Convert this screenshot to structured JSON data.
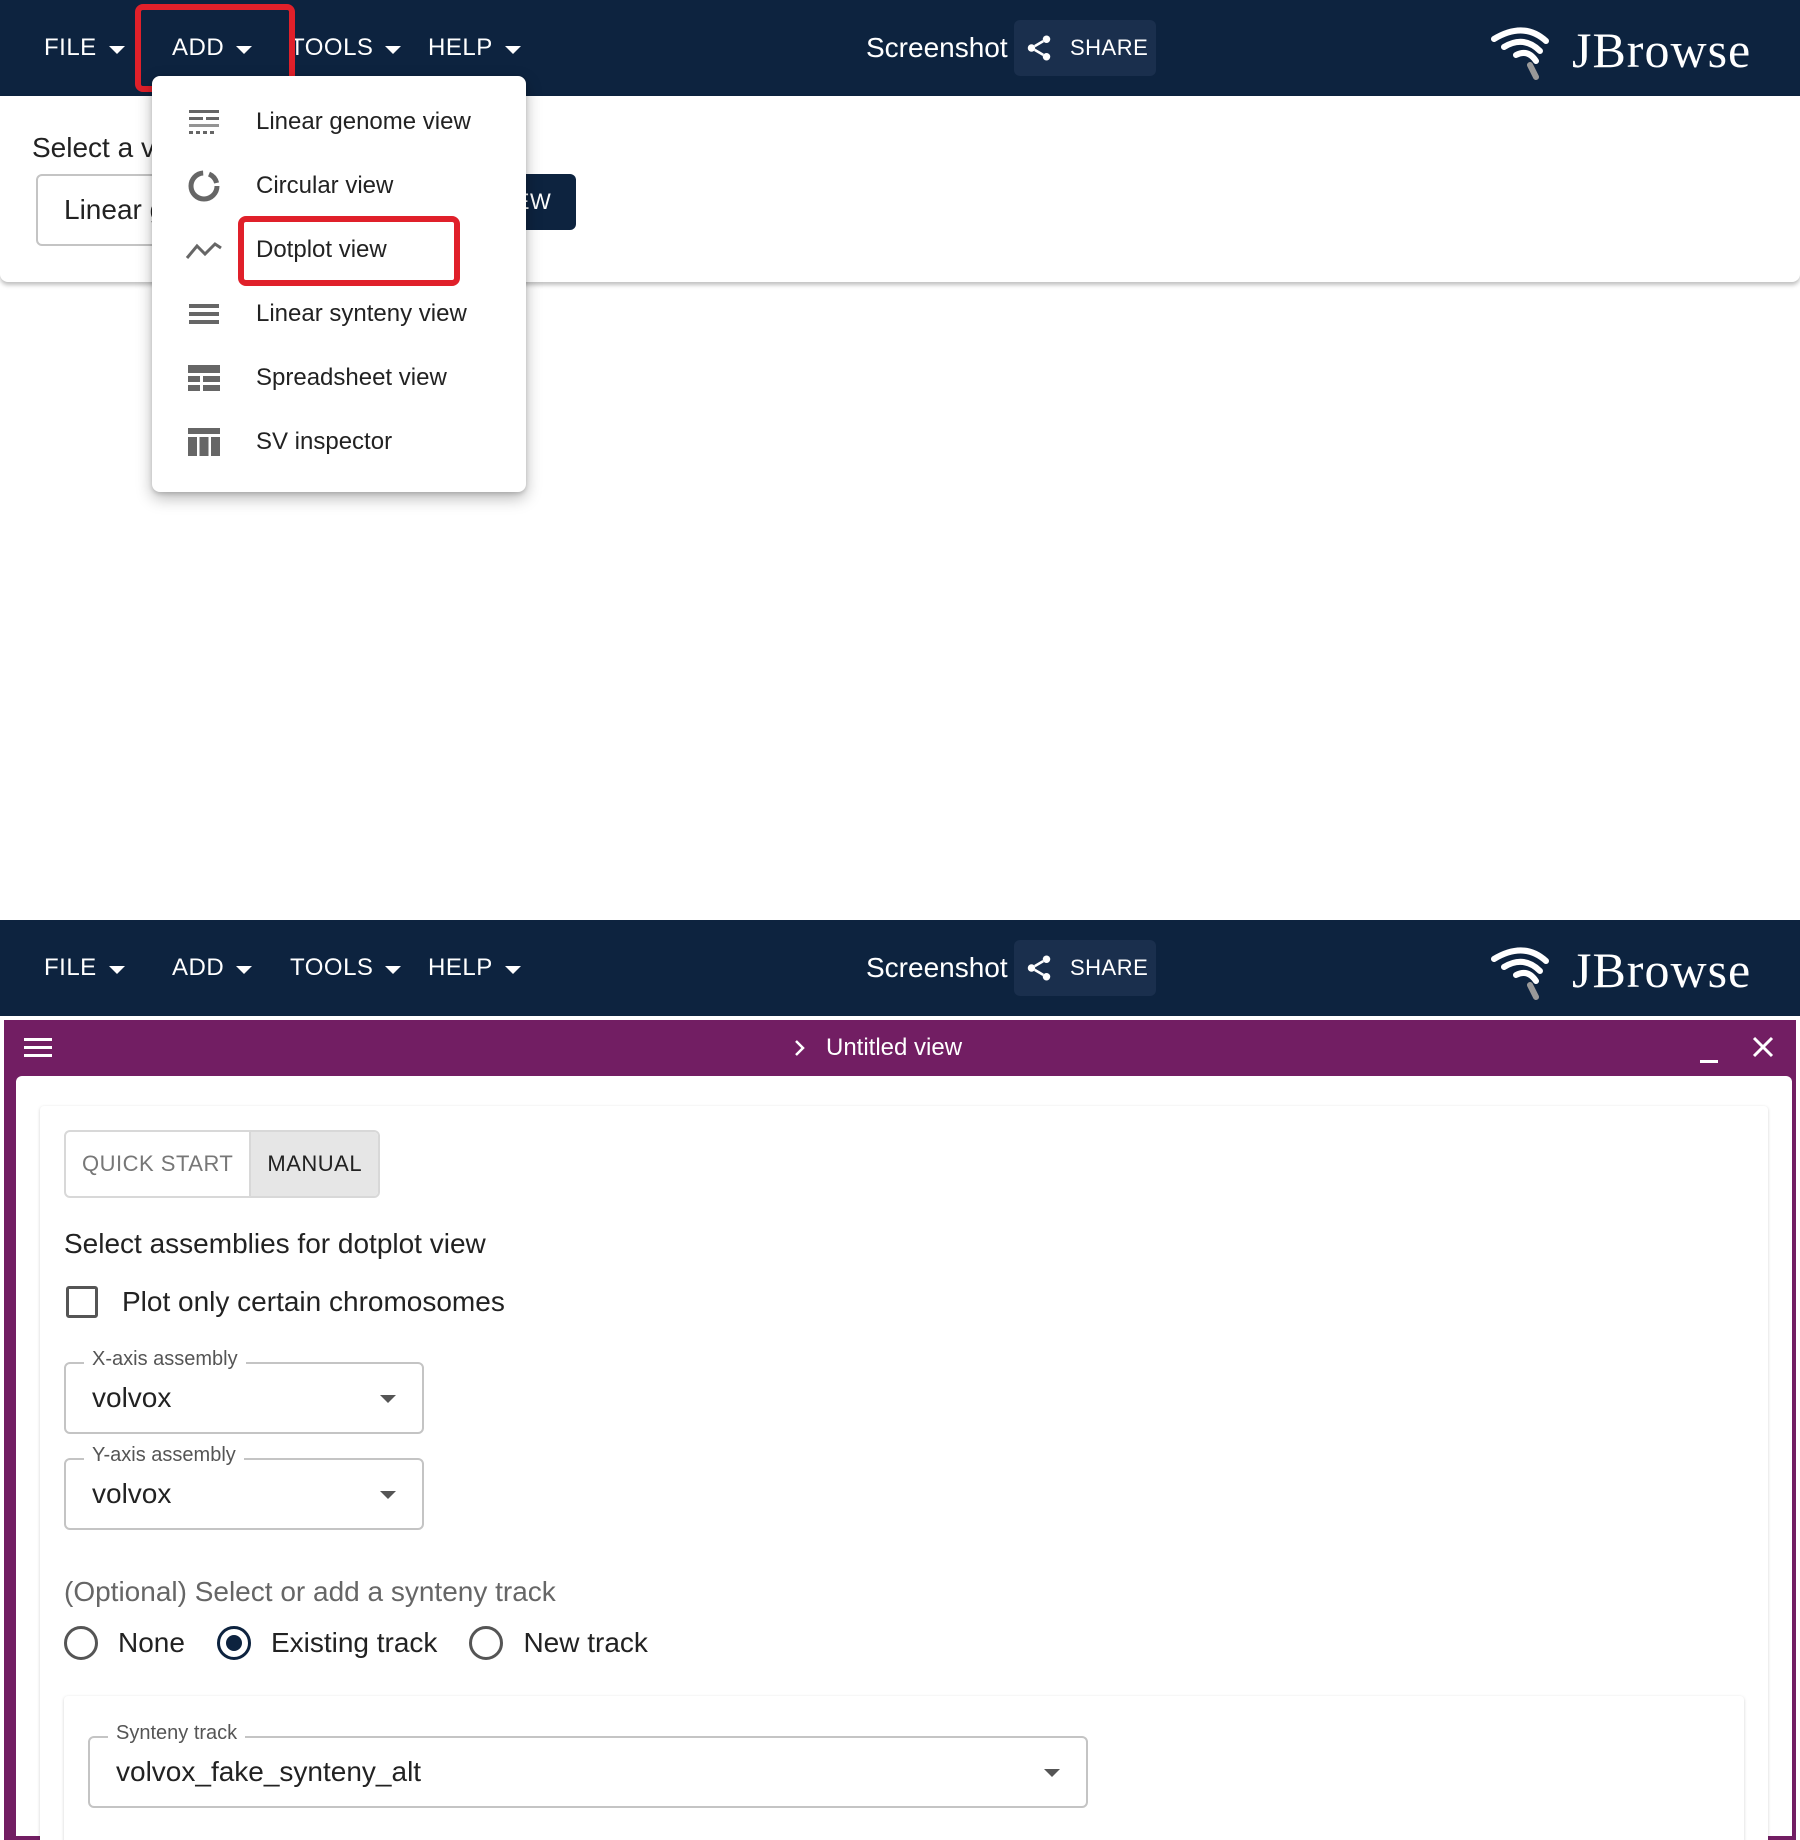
{
  "topbar": {
    "menus": [
      "FILE",
      "ADD",
      "TOOLS",
      "HELP"
    ],
    "session_name": "Screenshot",
    "share_label": "SHARE",
    "logo_text": "JBrowse",
    "background_color": "#0d233f"
  },
  "top_panel": {
    "select_label": "Select a v",
    "select_value": "Linear g",
    "launch_label": "EW"
  },
  "add_menu": {
    "items": [
      {
        "label": "Linear genome view",
        "icon": "linear-genome-icon"
      },
      {
        "label": "Circular view",
        "icon": "circular-icon"
      },
      {
        "label": "Dotplot view",
        "icon": "dotplot-icon"
      },
      {
        "label": "Linear synteny view",
        "icon": "synteny-icon"
      },
      {
        "label": "Spreadsheet view",
        "icon": "spreadsheet-icon"
      },
      {
        "label": "SV inspector",
        "icon": "sv-inspector-icon"
      }
    ],
    "highlighted_item": "Dotplot view",
    "highlight_color": "#e0202a"
  },
  "view": {
    "title": "Untitled view",
    "header_color": "#721e63",
    "tabs": [
      "QUICK START",
      "MANUAL"
    ],
    "active_tab": "MANUAL",
    "heading": "Select assemblies for dotplot view",
    "checkbox_label": "Plot only certain chromosomes",
    "x_axis": {
      "label": "X-axis assembly",
      "value": "volvox"
    },
    "y_axis": {
      "label": "Y-axis assembly",
      "value": "volvox"
    },
    "optional_label": "(Optional) Select or add a synteny track",
    "radio_options": [
      "None",
      "Existing track",
      "New track"
    ],
    "selected_radio": "Existing track",
    "synteny_track": {
      "label": "Synteny track",
      "value": "volvox_fake_synteny_alt"
    }
  }
}
